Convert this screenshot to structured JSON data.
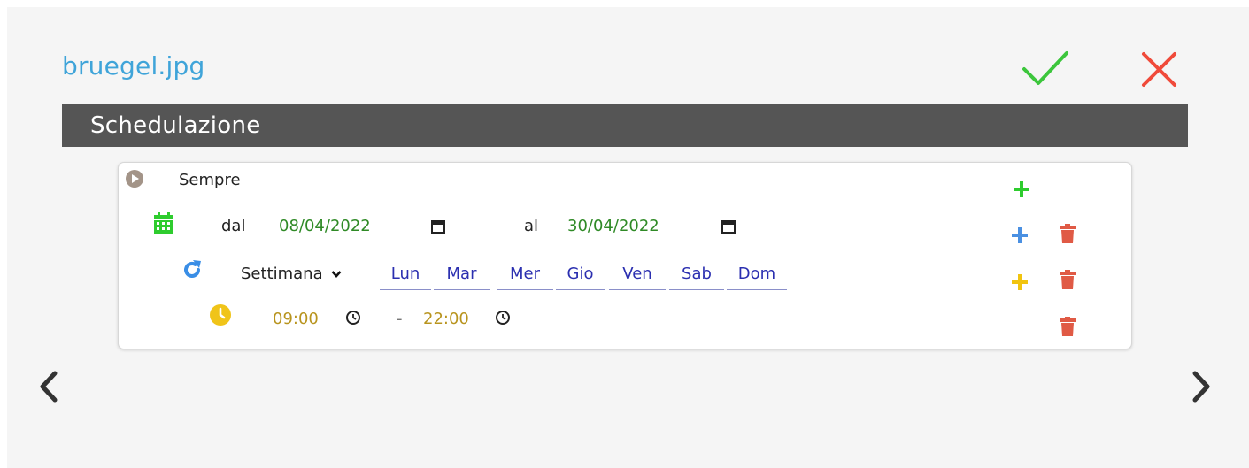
{
  "header": {
    "filename": "bruegel.jpg",
    "confirm_icon": "check-icon",
    "cancel_icon": "close-icon",
    "confirm_color": "#3cc63c",
    "cancel_color": "#f04a3a"
  },
  "section": {
    "title": "Schedulazione"
  },
  "schedule": {
    "root_label": "Sempre",
    "date_range": {
      "from_label": "dal",
      "from_value": "08/04/2022",
      "to_label": "al",
      "to_value": "30/04/2022"
    },
    "recurrence": {
      "period": "Settimana",
      "days": [
        "Lun",
        "Mar",
        "Mer",
        "Gio",
        "Ven",
        "Sab",
        "Dom"
      ]
    },
    "time_range": {
      "start": "09:00",
      "separator": "-",
      "end": "22:00"
    },
    "colors": {
      "add_root": "#2ecc2e",
      "add_date": "#4a90e2",
      "add_recurrence": "#f1c40f",
      "delete": "#e05a45",
      "calendar": "#2ecc2e",
      "repeat": "#3a8ee6",
      "clock": "#f0c419"
    }
  },
  "navigation": {
    "prev_icon": "chevron-left-icon",
    "next_icon": "chevron-right-icon"
  }
}
